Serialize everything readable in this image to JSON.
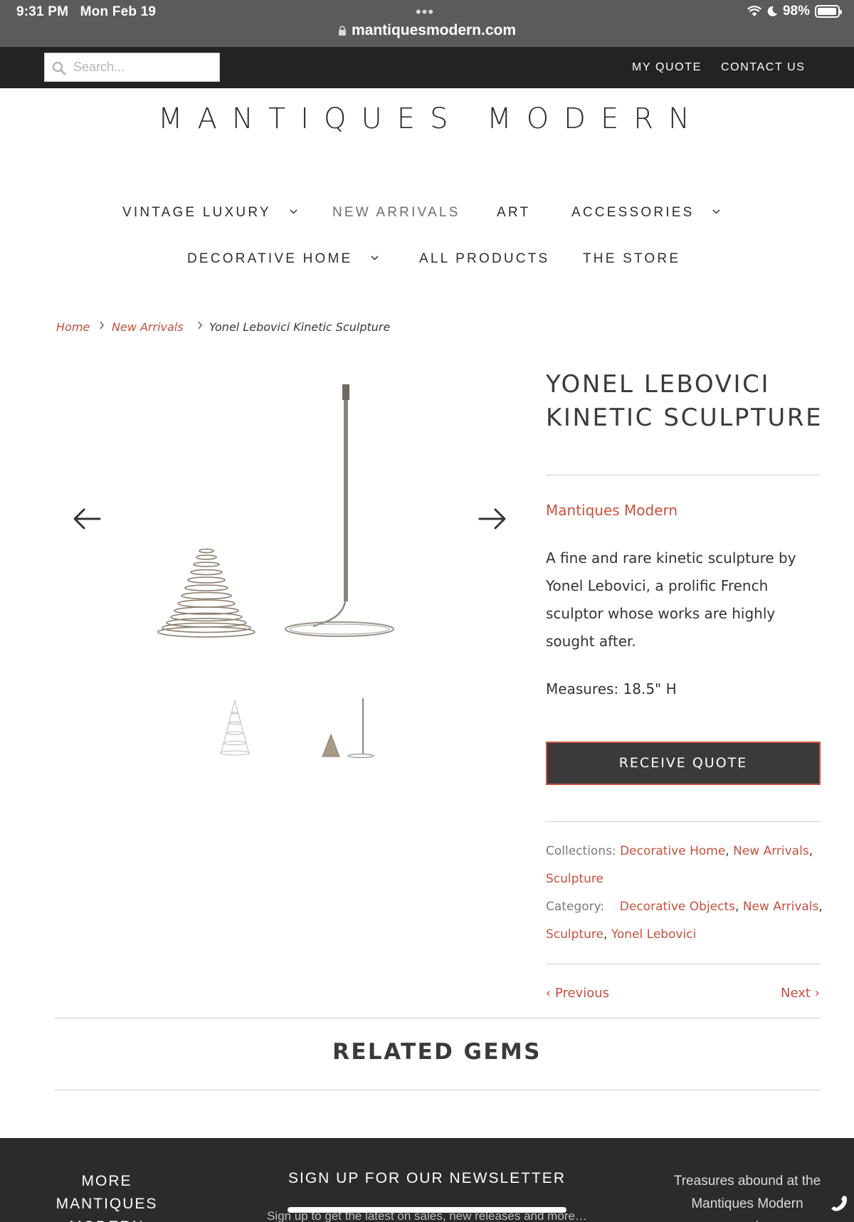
{
  "status_bar": {
    "time": "9:31 PM",
    "date": "Mon Feb 19",
    "url": "mantiquesmodern.com",
    "battery": "98%",
    "battery_level": 0.98
  },
  "topbar": {
    "search_placeholder": "Search...",
    "my_quote": "MY QUOTE",
    "contact_us": "CONTACT US"
  },
  "logo": "MANTIQUES MODERN",
  "nav": {
    "row1": [
      "VINTAGE LUXURY",
      "NEW ARRIVALS",
      "ART",
      "ACCESSORIES"
    ],
    "row2": [
      "DECORATIVE HOME",
      "ALL PRODUCTS",
      "THE STORE"
    ]
  },
  "breadcrumb": {
    "home": "Home",
    "section": "New Arrivals",
    "current": "Yonel Lebovici Kinetic Sculpture"
  },
  "product": {
    "title": "YONEL LEBOVICI KINETIC SCULPTURE",
    "vendor": "Mantiques Modern",
    "description": "A fine and rare kinetic sculpture by Yonel Lebovici, a prolific French sculptor whose works are highly sought after.",
    "measures": "Measures: 18.5\" H",
    "quote_button": "RECEIVE QUOTE",
    "collections_label": "Collections:",
    "collections": [
      "Decorative Home",
      "New Arrivals",
      "Sculpture"
    ],
    "category_label": "Category:",
    "categories": [
      "Decorative Objects",
      "New Arrivals",
      "Sculpture",
      "Yonel Lebovici"
    ],
    "previous": "Previous",
    "next": "Next"
  },
  "related_title": "RELATED GEMS",
  "footer": {
    "more_title": "MORE MANTIQUES MODERN",
    "newsletter_title": "SIGN UP FOR OUR NEWSLETTER",
    "newsletter_sub": "Sign up to get the latest on sales, new releases and more…",
    "right_text": "Treasures abound at the Mantiques Modern emporium"
  },
  "colors": {
    "accent": "#c6503d",
    "topbar": "#232323",
    "status_bar": "#5b5b5b",
    "button": "#3a3a3a",
    "footer": "#2b2b2b"
  },
  "icons": [
    "wifi-icon",
    "moon-icon",
    "battery-icon",
    "lock-icon",
    "search-icon",
    "chevron-down-icon",
    "chevron-right-icon",
    "arrow-left-icon",
    "arrow-right-icon",
    "phone-icon"
  ]
}
